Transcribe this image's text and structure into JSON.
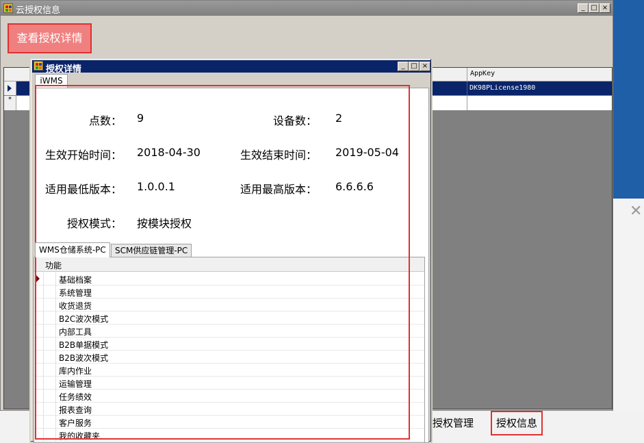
{
  "main_window": {
    "title": "云授权信息",
    "controls": [
      "_",
      "□",
      "×"
    ],
    "view_button_label": "查看授权详情",
    "grid": {
      "appkey_header": "AppKey",
      "rows": [
        {
          "appkey": "DK98PLicense1980"
        }
      ],
      "new_row_marker": "*"
    }
  },
  "bottom_tabs": [
    {
      "label": "授权管理"
    },
    {
      "label": "授权信息",
      "active": true
    }
  ],
  "dialog": {
    "title": "授权详情",
    "controls": [
      "_",
      "□",
      "×"
    ],
    "tab": "iWMS",
    "fields": {
      "points_label": "点数：",
      "points_value": "9",
      "devices_label": "设备数：",
      "devices_value": "2",
      "start_label": "生效开始时间：",
      "start_value": "2018-04-30",
      "end_label": "生效结束时间：",
      "end_value": "2019-05-04",
      "min_version_label": "适用最低版本：",
      "min_version_value": "1.0.0.1",
      "max_version_label": "适用最高版本：",
      "max_version_value": "6.6.6.6",
      "mode_label": "授权模式：",
      "mode_value": "按模块授权"
    },
    "sub_tabs": [
      "WMS仓储系统-PC",
      "SCM供应链管理-PC"
    ],
    "function_grid": {
      "header": "功能",
      "rows": [
        "基础档案",
        "系统管理",
        "收货退货",
        "B2C波次模式",
        "内部工具",
        "B2B单据模式",
        "B2B波次模式",
        "库内作业",
        "运输管理",
        "任务绩效",
        "报表查询",
        "客户服务",
        "我的收藏夹"
      ]
    }
  },
  "colors": {
    "highlight_red": "#e03030",
    "selection_blue": "#0a246a",
    "button_pink": "#f08080"
  }
}
